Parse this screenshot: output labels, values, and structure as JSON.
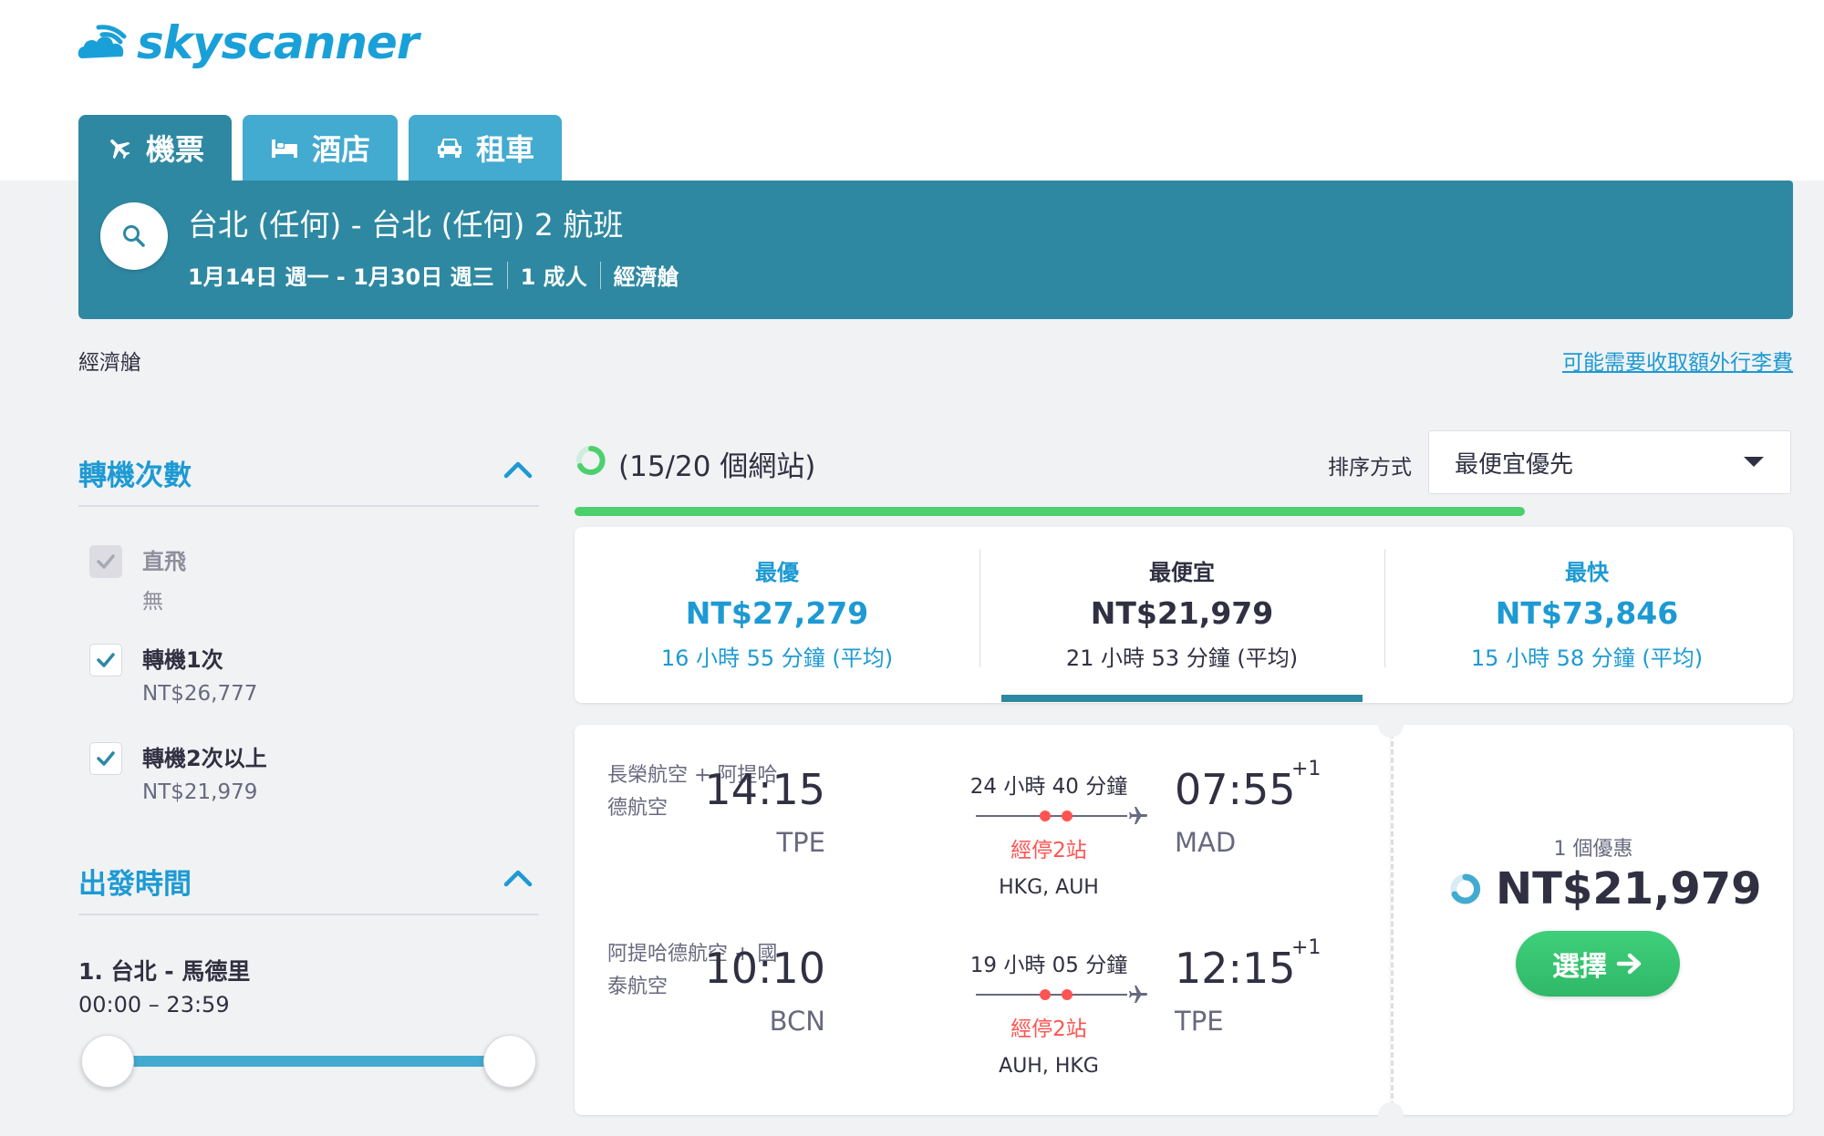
{
  "brand": {
    "name": "skyscanner",
    "color": "#1aa0d8"
  },
  "tabs": [
    {
      "label": "機票",
      "icon": "plane-icon",
      "active": true
    },
    {
      "label": "酒店",
      "icon": "bed-icon",
      "active": false
    },
    {
      "label": "租車",
      "icon": "car-icon",
      "active": false
    }
  ],
  "search": {
    "title": "台北 (任何) - 台北 (任何) 2 航班",
    "dates": "1月14日 週一 - 1月30日 週三",
    "travellers": "1 成人",
    "cabin": "經濟艙"
  },
  "cabin_label": "經濟艙",
  "baggage_link": "可能需要收取額外行李費",
  "filters": {
    "stops": {
      "heading": "轉機次數",
      "options": [
        {
          "label": "直飛",
          "price": "無",
          "checked": true,
          "disabled": true
        },
        {
          "label": "轉機1次",
          "price": "NT$26,777",
          "checked": true,
          "disabled": false
        },
        {
          "label": "轉機2次以上",
          "price": "NT$21,979",
          "checked": true,
          "disabled": false
        }
      ]
    },
    "departure": {
      "heading": "出發時間",
      "route": "1. 台北 - 馬德里",
      "range": "00:00 – 23:59"
    }
  },
  "results": {
    "sites_count": "(15/20 個網站)",
    "sort_label": "排序方式",
    "sort_value": "最便宜優先",
    "progress": 0.78
  },
  "tiles": [
    {
      "label": "最優",
      "price": "NT$27,279",
      "duration": "16 小時 55 分鐘 (平均)",
      "selected": false
    },
    {
      "label": "最便宜",
      "price": "NT$21,979",
      "duration": "21 小時 53 分鐘 (平均)",
      "selected": true
    },
    {
      "label": "最快",
      "price": "NT$73,846",
      "duration": "15 小時 58 分鐘 (平均)",
      "selected": false
    }
  ],
  "itinerary": {
    "legs": [
      {
        "airline": "長榮航空 + 阿提哈德航空",
        "dep_time": "14:15",
        "dep_code": "TPE",
        "duration": "24 小時 40 分鐘",
        "stops": "經停2站",
        "via": "HKG, AUH",
        "arr_time": "07:55",
        "arr_plus": "+1",
        "arr_code": "MAD"
      },
      {
        "airline": "阿提哈德航空 + 國泰航空",
        "dep_time": "10:10",
        "dep_code": "BCN",
        "duration": "19 小時 05 分鐘",
        "stops": "經停2站",
        "via": "AUH, HKG",
        "arr_time": "12:15",
        "arr_plus": "+1",
        "arr_code": "TPE"
      }
    ],
    "deals": "1 個優惠",
    "price": "NT$21,979",
    "select_label": "選擇"
  },
  "colors": {
    "primary": "#2e88a2",
    "accent_blue": "#1d9ad3",
    "stop_red": "#ff5452",
    "cta_green": "#3fcf7a",
    "progress_green": "#4cd06e"
  }
}
